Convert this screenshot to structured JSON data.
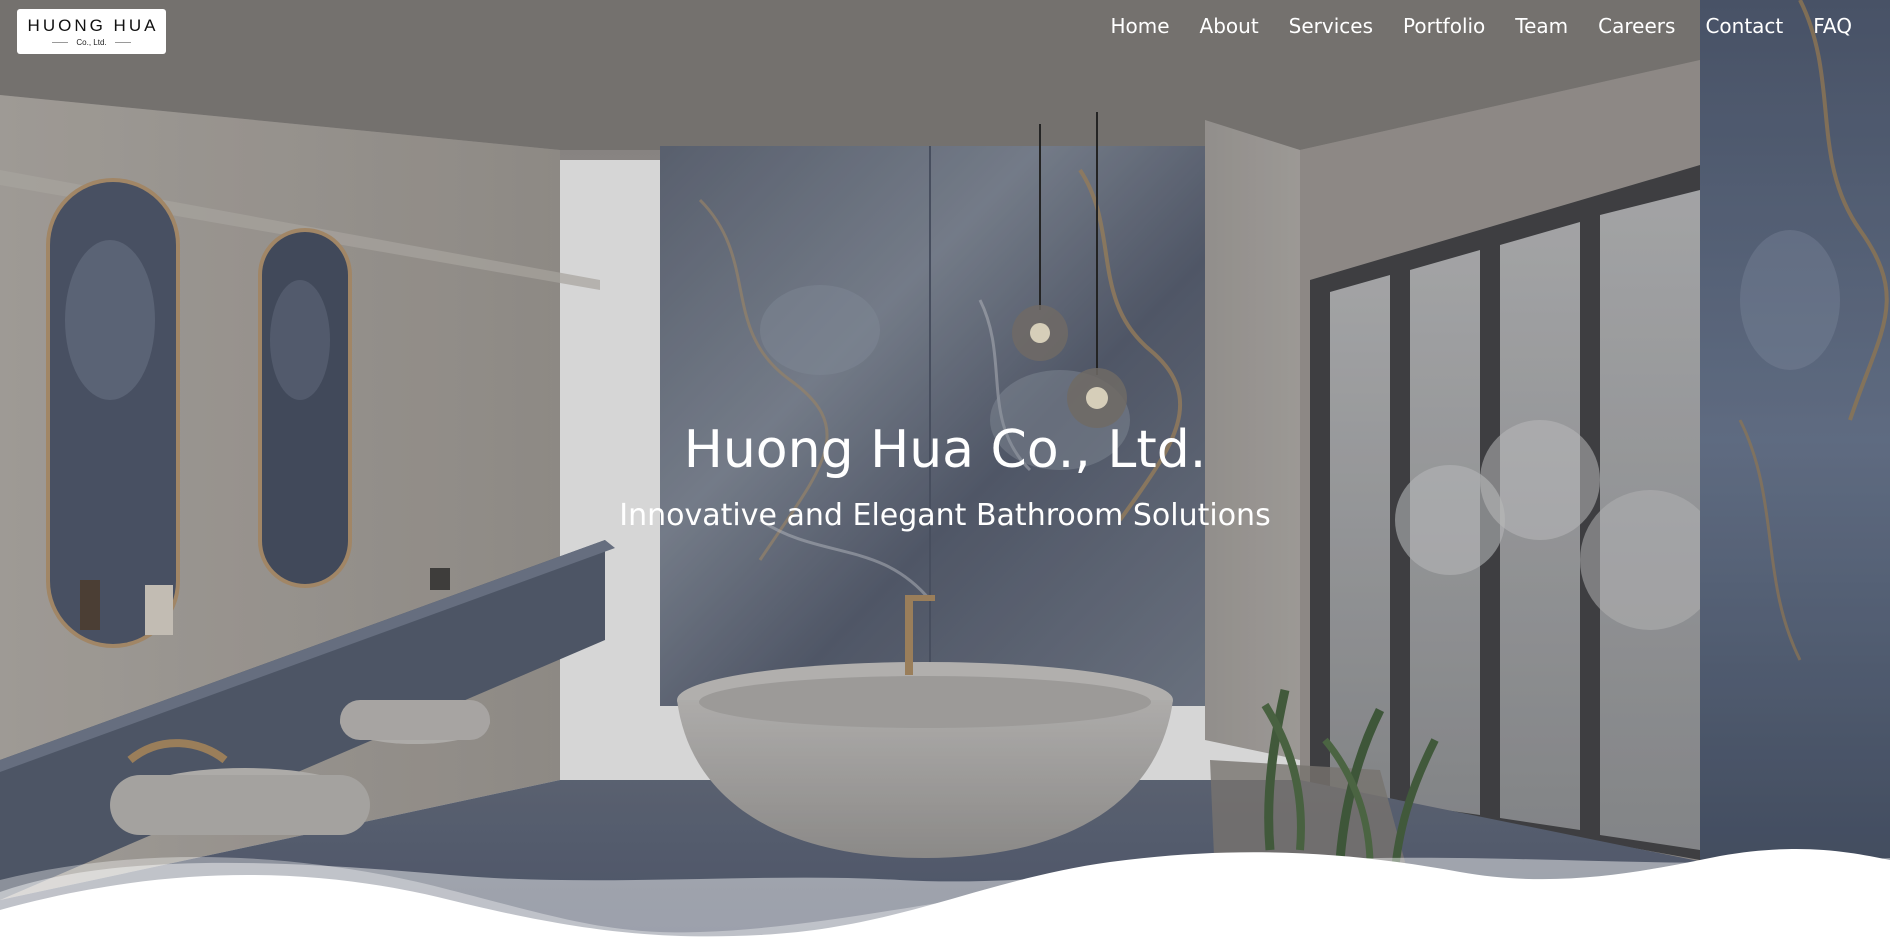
{
  "brand": {
    "logo_name": "HUONG HUA",
    "logo_sub": "Co., Ltd."
  },
  "nav": {
    "items": [
      {
        "label": "Home"
      },
      {
        "label": "About"
      },
      {
        "label": "Services"
      },
      {
        "label": "Portfolio"
      },
      {
        "label": "Team"
      },
      {
        "label": "Careers"
      },
      {
        "label": "Contact"
      },
      {
        "label": "FAQ"
      }
    ]
  },
  "hero": {
    "title": "Huong Hua Co., Ltd.",
    "subtitle": "Innovative and Elegant Bathroom Solutions"
  },
  "colors": {
    "nav_text": "#ffffff",
    "hero_text": "#ffffff",
    "logo_bg": "#ffffff",
    "wave": "#ffffff"
  }
}
